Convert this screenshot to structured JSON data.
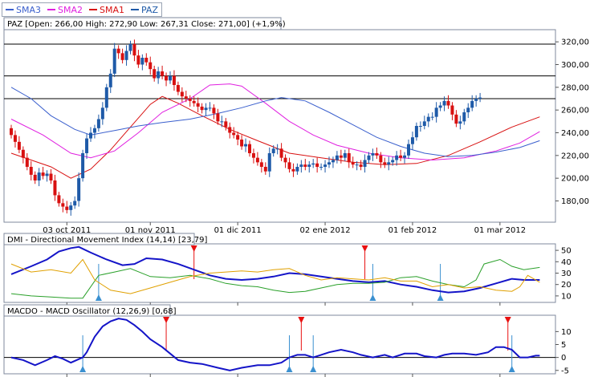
{
  "legend": {
    "items": [
      {
        "label": "SMA3",
        "color": "#3a5fcd"
      },
      {
        "label": "SMA2",
        "color": "#e020e0"
      },
      {
        "label": "SMA1",
        "color": "#d81010"
      },
      {
        "label": "PAZ",
        "color": "#1e5aa8"
      }
    ]
  },
  "panels": {
    "price_title": "PAZ [Open: 266,00  High: 272,90  Low: 267,31  Close: 271,00] (+1,9%)",
    "dmi_title": "DMI - Directional Movement Index (14,14) [23,79]",
    "macd_title": "MACDO - MACD Oscillator (12,26,9) [0,68]"
  },
  "chart_data": [
    {
      "type": "candlestick",
      "title": "PAZ [Open: 266,00  High: 272,90  Low: 267,31  Close: 271,00] (+1,9%)",
      "ylim": [
        162,
        330
      ],
      "yticks": [
        180,
        200,
        220,
        240,
        260,
        280,
        300,
        320
      ],
      "ytick_labels": [
        "180,00",
        "200,00",
        "220,00",
        "240,00",
        "260,00",
        "280,00",
        "300,00",
        "320,00"
      ],
      "x_tick_labels": [
        "03 oct 2011",
        "01 nov 2011",
        "01 dic 2011",
        "02 ene 2012",
        "01 feb 2012",
        "01 mar 2012"
      ],
      "x_tick_index": [
        14,
        35,
        57,
        79,
        101,
        123
      ],
      "horizontal_lines": [
        318,
        290,
        270
      ],
      "grid": false,
      "up_color": "#1e5aa8",
      "down_color": "#d81010",
      "close": [
        238,
        232,
        225,
        218,
        210,
        203,
        198,
        205,
        202,
        204,
        198,
        185,
        178,
        175,
        172,
        176,
        180,
        200,
        222,
        235,
        240,
        244,
        252,
        262,
        280,
        292,
        314,
        310,
        304,
        312,
        318,
        308,
        300,
        306,
        302,
        296,
        288,
        294,
        290,
        286,
        290,
        282,
        276,
        272,
        270,
        268,
        266,
        263,
        260,
        262,
        262,
        257,
        250,
        250,
        245,
        240,
        238,
        234,
        228,
        230,
        222,
        218,
        214,
        210,
        206,
        222,
        226,
        226,
        218,
        214,
        208,
        206,
        210,
        212,
        210,
        212,
        213,
        210,
        210,
        212,
        214,
        216,
        220,
        218,
        222,
        214,
        212,
        212,
        210,
        216,
        220,
        222,
        220,
        214,
        212,
        214,
        216,
        220,
        218,
        220,
        230,
        236,
        246,
        246,
        250,
        254,
        254,
        262,
        264,
        268,
        264,
        256,
        248,
        250,
        258,
        262,
        268,
        270,
        271
      ],
      "series": [
        {
          "name": "SMA1",
          "color": "#d81010",
          "values": [
            [
              0,
              222
            ],
            [
              10,
              210
            ],
            [
              15,
              200
            ],
            [
              20,
              208
            ],
            [
              25,
              225
            ],
            [
              30,
              245
            ],
            [
              35,
              265
            ],
            [
              38,
              272
            ],
            [
              42,
              266
            ],
            [
              48,
              255
            ],
            [
              55,
              243
            ],
            [
              62,
              233
            ],
            [
              70,
              222
            ],
            [
              78,
              218
            ],
            [
              86,
              214
            ],
            [
              94,
              212
            ],
            [
              102,
              213
            ],
            [
              110,
              220
            ],
            [
              118,
              232
            ],
            [
              126,
              245
            ],
            [
              133,
              254
            ]
          ]
        },
        {
          "name": "SMA2",
          "color": "#e020e0",
          "values": [
            [
              0,
              252
            ],
            [
              8,
              238
            ],
            [
              15,
              222
            ],
            [
              20,
              218
            ],
            [
              26,
              224
            ],
            [
              32,
              240
            ],
            [
              38,
              258
            ],
            [
              45,
              270
            ],
            [
              50,
              282
            ],
            [
              55,
              283
            ],
            [
              58,
              281
            ],
            [
              64,
              266
            ],
            [
              70,
              250
            ],
            [
              76,
              238
            ],
            [
              82,
              229
            ],
            [
              90,
              222
            ],
            [
              98,
              218
            ],
            [
              106,
              216
            ],
            [
              114,
              218
            ],
            [
              122,
              224
            ],
            [
              128,
              231
            ],
            [
              133,
              241
            ]
          ]
        },
        {
          "name": "SMA3",
          "color": "#3a5fcd",
          "values": [
            [
              0,
              280
            ],
            [
              5,
              270
            ],
            [
              10,
              255
            ],
            [
              16,
              243
            ],
            [
              20,
              238
            ],
            [
              26,
              242
            ],
            [
              32,
              246
            ],
            [
              38,
              249
            ],
            [
              45,
              252
            ],
            [
              52,
              257
            ],
            [
              58,
              262
            ],
            [
              64,
              268
            ],
            [
              68,
              271
            ],
            [
              74,
              268
            ],
            [
              80,
              258
            ],
            [
              86,
              247
            ],
            [
              92,
              236
            ],
            [
              98,
              228
            ],
            [
              104,
              222
            ],
            [
              110,
              219
            ],
            [
              116,
              220
            ],
            [
              122,
              223
            ],
            [
              128,
              227
            ],
            [
              133,
              233
            ]
          ]
        }
      ]
    },
    {
      "type": "line",
      "title": "DMI - Directional Movement Index (14,14) [23,79]",
      "ylim": [
        5,
        55
      ],
      "yticks": [
        10,
        20,
        30,
        40,
        50
      ],
      "x_tick_index": [
        14,
        35,
        57,
        79,
        101,
        123
      ],
      "series": [
        {
          "name": "ADX",
          "color": "#1414c8",
          "values": [
            [
              0,
              29
            ],
            [
              5,
              36
            ],
            [
              9,
              42
            ],
            [
              12,
              49
            ],
            [
              15,
              52
            ],
            [
              17,
              53
            ],
            [
              20,
              48
            ],
            [
              24,
              42
            ],
            [
              28,
              37
            ],
            [
              31,
              38
            ],
            [
              34,
              43
            ],
            [
              38,
              42
            ],
            [
              42,
              38
            ],
            [
              46,
              33
            ],
            [
              50,
              28
            ],
            [
              54,
              25
            ],
            [
              58,
              24
            ],
            [
              62,
              25
            ],
            [
              66,
              27
            ],
            [
              70,
              30
            ],
            [
              74,
              29
            ],
            [
              78,
              27
            ],
            [
              82,
              25
            ],
            [
              86,
              23
            ],
            [
              90,
              22
            ],
            [
              94,
              23
            ],
            [
              98,
              20
            ],
            [
              102,
              18
            ],
            [
              106,
              15
            ],
            [
              110,
              13
            ],
            [
              114,
              14
            ],
            [
              118,
              17
            ],
            [
              122,
              21
            ],
            [
              126,
              25
            ],
            [
              129,
              24
            ],
            [
              133,
              24
            ]
          ]
        },
        {
          "name": "+DI",
          "color": "#2aa02a",
          "values": [
            [
              0,
              12
            ],
            [
              5,
              10
            ],
            [
              10,
              9
            ],
            [
              15,
              8
            ],
            [
              18,
              8
            ],
            [
              22,
              28
            ],
            [
              26,
              31
            ],
            [
              30,
              34
            ],
            [
              35,
              27
            ],
            [
              40,
              26
            ],
            [
              45,
              28
            ],
            [
              50,
              25
            ],
            [
              54,
              21
            ],
            [
              58,
              19
            ],
            [
              62,
              18
            ],
            [
              66,
              15
            ],
            [
              70,
              13
            ],
            [
              74,
              14
            ],
            [
              78,
              17
            ],
            [
              82,
              20
            ],
            [
              86,
              21
            ],
            [
              90,
              21
            ],
            [
              94,
              22
            ],
            [
              98,
              26
            ],
            [
              102,
              27
            ],
            [
              106,
              23
            ],
            [
              110,
              20
            ],
            [
              114,
              18
            ],
            [
              117,
              24
            ],
            [
              119,
              38
            ],
            [
              123,
              42
            ],
            [
              126,
              36
            ],
            [
              129,
              33
            ],
            [
              133,
              35
            ]
          ]
        },
        {
          "name": "-DI",
          "color": "#e0a000",
          "values": [
            [
              0,
              38
            ],
            [
              5,
              31
            ],
            [
              10,
              33
            ],
            [
              15,
              30
            ],
            [
              18,
              42
            ],
            [
              21,
              24
            ],
            [
              25,
              15
            ],
            [
              30,
              12
            ],
            [
              35,
              17
            ],
            [
              40,
              22
            ],
            [
              45,
              27
            ],
            [
              50,
              30
            ],
            [
              54,
              31
            ],
            [
              58,
              32
            ],
            [
              62,
              31
            ],
            [
              66,
              33
            ],
            [
              70,
              34
            ],
            [
              74,
              28
            ],
            [
              78,
              24
            ],
            [
              82,
              26
            ],
            [
              86,
              25
            ],
            [
              90,
              24
            ],
            [
              94,
              26
            ],
            [
              98,
              23
            ],
            [
              102,
              23
            ],
            [
              106,
              18
            ],
            [
              110,
              20
            ],
            [
              114,
              17
            ],
            [
              118,
              18
            ],
            [
              122,
              15
            ],
            [
              126,
              14
            ],
            [
              128,
              18
            ],
            [
              130,
              28
            ],
            [
              133,
              22
            ]
          ]
        }
      ],
      "markers": {
        "sell_index": [
          46,
          89
        ],
        "buy_index": [
          22,
          91,
          108
        ]
      }
    },
    {
      "type": "line",
      "title": "MACDO - MACD Oscillator (12,26,9) [0,68]",
      "ylim": [
        -6,
        16
      ],
      "yticks": [
        -5,
        0,
        5,
        10
      ],
      "x_tick_index": [
        14,
        35,
        57,
        79,
        101,
        123
      ],
      "series": [
        {
          "name": "MACDO",
          "color": "#1414c8",
          "values": [
            [
              0,
              0
            ],
            [
              3,
              -1
            ],
            [
              6,
              -3
            ],
            [
              9,
              -1
            ],
            [
              11,
              0.5
            ],
            [
              13,
              -0.5
            ],
            [
              15,
              -2
            ],
            [
              18,
              0
            ],
            [
              19,
              2
            ],
            [
              21,
              8
            ],
            [
              23,
              12
            ],
            [
              25,
              14
            ],
            [
              27,
              15
            ],
            [
              29,
              14.5
            ],
            [
              31,
              12.5
            ],
            [
              33,
              10
            ],
            [
              35,
              7
            ],
            [
              38,
              4
            ],
            [
              40,
              1.5
            ],
            [
              42,
              -1
            ],
            [
              45,
              -2
            ],
            [
              48,
              -2.5
            ],
            [
              52,
              -4
            ],
            [
              55,
              -5
            ],
            [
              58,
              -4
            ],
            [
              62,
              -3
            ],
            [
              65,
              -3
            ],
            [
              68,
              -2
            ],
            [
              70,
              0
            ],
            [
              72,
              1
            ],
            [
              74,
              1
            ],
            [
              76,
              0
            ],
            [
              78,
              1
            ],
            [
              80,
              2
            ],
            [
              83,
              3
            ],
            [
              86,
              2
            ],
            [
              88,
              1
            ],
            [
              91,
              0
            ],
            [
              94,
              1
            ],
            [
              96,
              0
            ],
            [
              99,
              1.5
            ],
            [
              102,
              1.5
            ],
            [
              104,
              0.5
            ],
            [
              107,
              0
            ],
            [
              109,
              1
            ],
            [
              111,
              1.5
            ],
            [
              114,
              1.5
            ],
            [
              117,
              1
            ],
            [
              120,
              2
            ],
            [
              122,
              4
            ],
            [
              124,
              4
            ],
            [
              126,
              3
            ],
            [
              128,
              0
            ],
            [
              130,
              0
            ],
            [
              132,
              0.7
            ],
            [
              133,
              0.7
            ]
          ]
        }
      ],
      "markers": {
        "sell_index": [
          39,
          73,
          125
        ],
        "buy_index": [
          18,
          70,
          76,
          126
        ]
      }
    }
  ]
}
